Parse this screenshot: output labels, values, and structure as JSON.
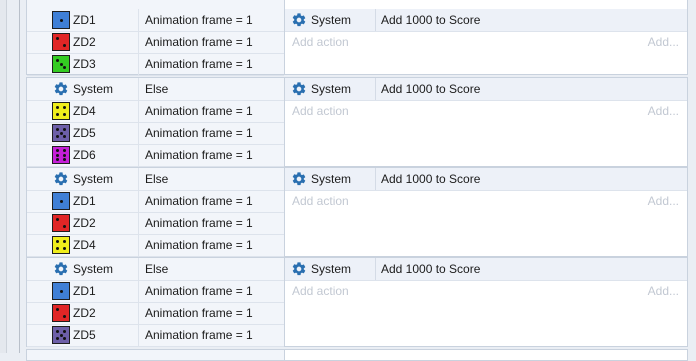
{
  "colors": {
    "zd1": "#3f7fd6",
    "zd2": "#e12626",
    "zd3": "#34cc22",
    "zd4": "#f0ee1c",
    "zd5": "#6d5fa8",
    "zd6": "#c51fd8"
  },
  "icons": {
    "system": "gear-icon",
    "die": "die-face-icon"
  },
  "events": [
    {
      "conditions": [
        {
          "object": "ZD1",
          "icon": "die",
          "color_key": "zd1",
          "pips": 1,
          "text": "Animation frame = 1"
        },
        {
          "object": "ZD2",
          "icon": "die",
          "color_key": "zd2",
          "pips": 2,
          "text": "Animation frame = 1"
        },
        {
          "object": "ZD3",
          "icon": "die",
          "color_key": "zd3",
          "pips": 3,
          "text": "Animation frame = 1"
        }
      ],
      "action": {
        "object": "System",
        "text": "Add 1000 to Score"
      },
      "add_action": "Add action",
      "add_short": "Add..."
    },
    {
      "conditions": [
        {
          "object": "System",
          "icon": "system",
          "text": "Else"
        },
        {
          "object": "ZD4",
          "icon": "die",
          "color_key": "zd4",
          "pips": 4,
          "text": "Animation frame = 1"
        },
        {
          "object": "ZD5",
          "icon": "die",
          "color_key": "zd5",
          "pips": 5,
          "text": "Animation frame = 1"
        },
        {
          "object": "ZD6",
          "icon": "die",
          "color_key": "zd6",
          "pips": 6,
          "text": "Animation frame = 1"
        }
      ],
      "action": {
        "object": "System",
        "text": "Add 1000 to Score"
      },
      "add_action": "Add action",
      "add_short": "Add..."
    },
    {
      "conditions": [
        {
          "object": "System",
          "icon": "system",
          "text": "Else"
        },
        {
          "object": "ZD1",
          "icon": "die",
          "color_key": "zd1",
          "pips": 1,
          "text": "Animation frame = 1"
        },
        {
          "object": "ZD2",
          "icon": "die",
          "color_key": "zd2",
          "pips": 2,
          "text": "Animation frame = 1"
        },
        {
          "object": "ZD4",
          "icon": "die",
          "color_key": "zd4",
          "pips": 4,
          "text": "Animation frame = 1"
        }
      ],
      "action": {
        "object": "System",
        "text": "Add 1000 to Score"
      },
      "add_action": "Add action",
      "add_short": "Add..."
    },
    {
      "conditions": [
        {
          "object": "System",
          "icon": "system",
          "text": "Else"
        },
        {
          "object": "ZD1",
          "icon": "die",
          "color_key": "zd1",
          "pips": 1,
          "text": "Animation frame = 1"
        },
        {
          "object": "ZD2",
          "icon": "die",
          "color_key": "zd2",
          "pips": 2,
          "text": "Animation frame = 1"
        },
        {
          "object": "ZD5",
          "icon": "die",
          "color_key": "zd5",
          "pips": 5,
          "text": "Animation frame = 1"
        }
      ],
      "action": {
        "object": "System",
        "text": "Add 1000 to Score"
      },
      "add_action": "Add action",
      "add_short": "Add..."
    }
  ]
}
